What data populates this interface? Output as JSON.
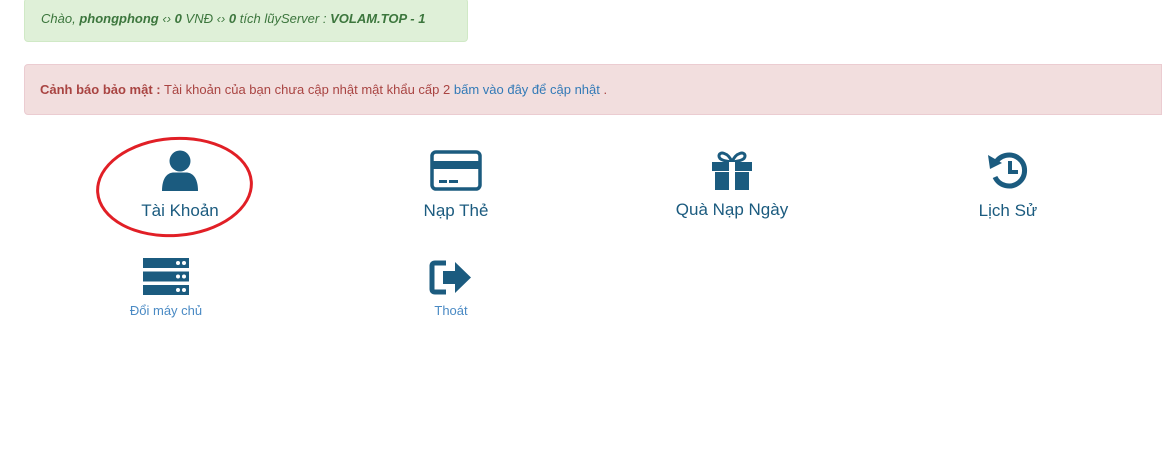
{
  "welcome": {
    "greeting": "Chào,",
    "username": "phongphong",
    "sep1": "‹›",
    "vnd_amount": "0",
    "vnd_label": "VNĐ",
    "sep2": "‹›",
    "points_amount": "0",
    "points_label": "tích lũy",
    "server_label": "Server :",
    "server_name": "VOLAM.TOP - 1"
  },
  "alert": {
    "title": "Cảnh báo bảo mật :",
    "message": "Tài khoản của bạn chưa cập nhật mật khẩu cấp 2",
    "link_text": "bấm vào đây để cập nhật",
    "suffix": "."
  },
  "menu": {
    "account": {
      "label": "Tài Khoản",
      "icon": "user-icon"
    },
    "topup": {
      "label": "Nạp Thẻ",
      "icon": "credit-card-icon"
    },
    "daily_gift": {
      "label": "Quà Nạp Ngày",
      "icon": "gift-icon"
    },
    "history": {
      "label": "Lịch Sử",
      "icon": "history-icon"
    },
    "change_server": {
      "label": "Đổi máy chủ",
      "icon": "server-icon"
    },
    "logout": {
      "label": "Thoát",
      "icon": "sign-out-icon"
    }
  },
  "colors": {
    "icon": "#1b5b7f",
    "highlight_circle": "#e11f26",
    "alert_text": "#a94442",
    "link": "#337ab7"
  }
}
